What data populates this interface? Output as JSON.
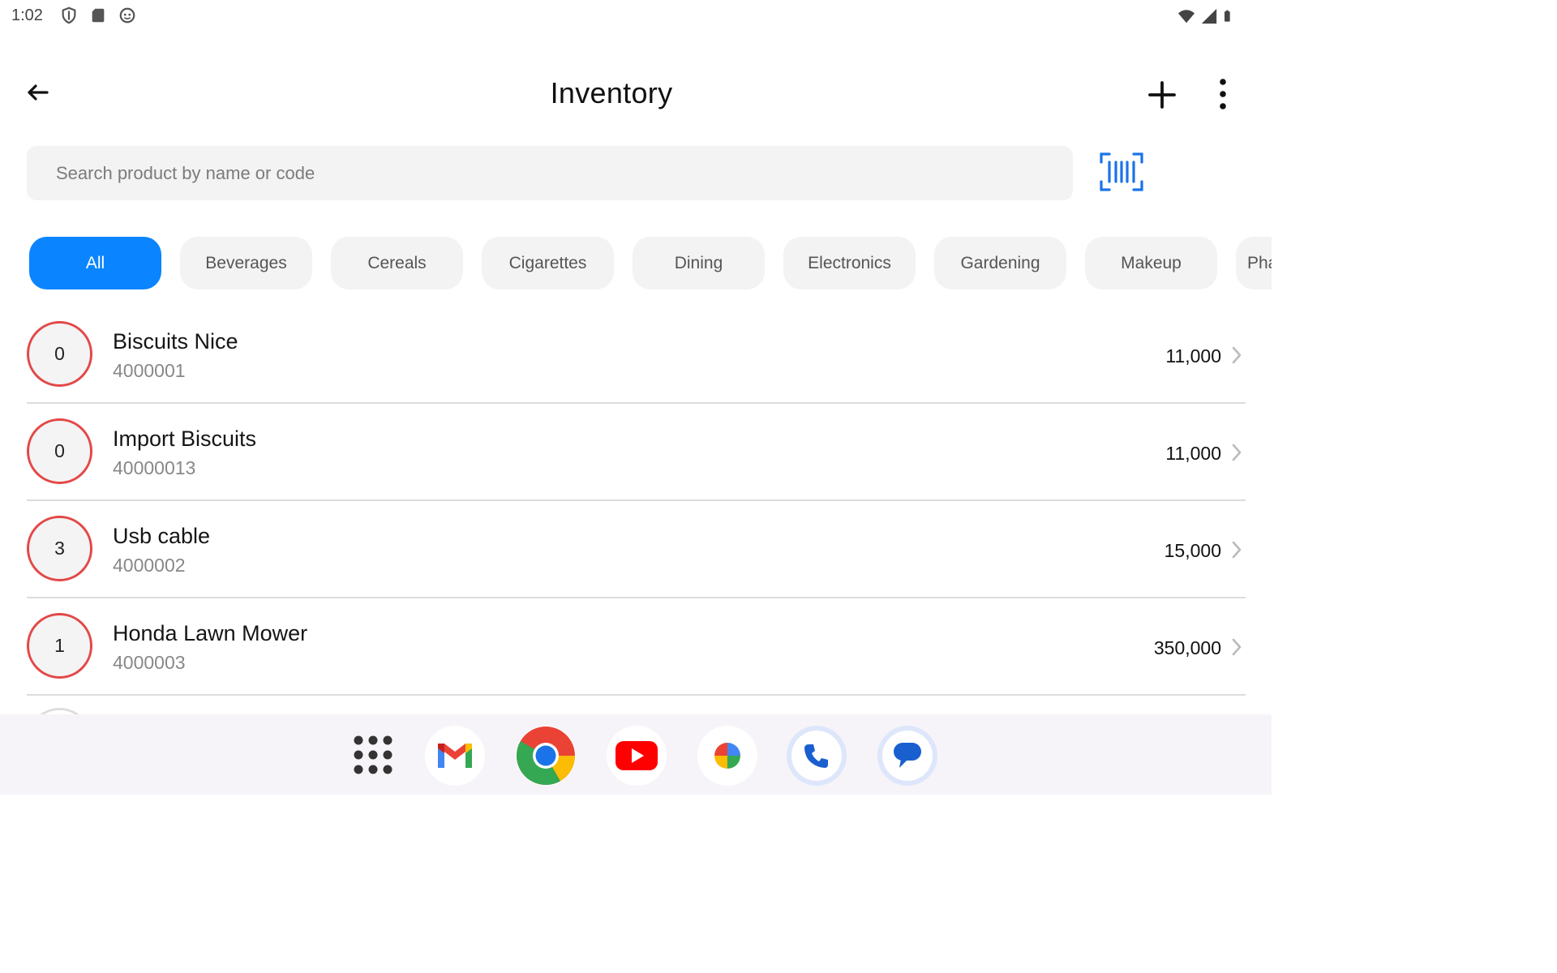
{
  "status_bar": {
    "time": "1:02",
    "left_icons": [
      "shield-icon",
      "sd-card-icon",
      "face-icon"
    ],
    "right_icons": [
      "wifi-icon",
      "signal-icon",
      "battery-icon"
    ]
  },
  "app_bar": {
    "title": "Inventory",
    "back_icon": "arrow-left-icon",
    "add_icon": "plus-icon",
    "more_icon": "more-vertical-icon"
  },
  "search": {
    "placeholder": "Search product by name or code",
    "scan_icon": "barcode-scan-icon"
  },
  "categories": [
    {
      "label": "All",
      "active": true
    },
    {
      "label": "Beverages",
      "active": false
    },
    {
      "label": "Cereals",
      "active": false
    },
    {
      "label": "Cigarettes",
      "active": false
    },
    {
      "label": "Dining",
      "active": false
    },
    {
      "label": "Electronics",
      "active": false
    },
    {
      "label": "Gardening",
      "active": false
    },
    {
      "label": "Makeup",
      "active": false
    },
    {
      "label": "Pha",
      "active": false
    }
  ],
  "products": [
    {
      "qty": "0",
      "name": "Biscuits Nice",
      "code": "4000001",
      "price": "11,000"
    },
    {
      "qty": "0",
      "name": "Import Biscuits",
      "code": "40000013",
      "price": "11,000"
    },
    {
      "qty": "3",
      "name": "Usb cable",
      "code": "4000002",
      "price": "15,000"
    },
    {
      "qty": "1",
      "name": "Honda Lawn Mower",
      "code": "4000003",
      "price": "350,000"
    }
  ],
  "colors": {
    "accent": "#0a84ff",
    "qty_ring": "#e34848",
    "scan_icon": "#1a73e8"
  },
  "dock": {
    "apps": [
      "apps-grid-icon",
      "gmail-icon",
      "chrome-icon",
      "youtube-icon",
      "photos-icon",
      "phone-icon",
      "messages-icon"
    ]
  }
}
